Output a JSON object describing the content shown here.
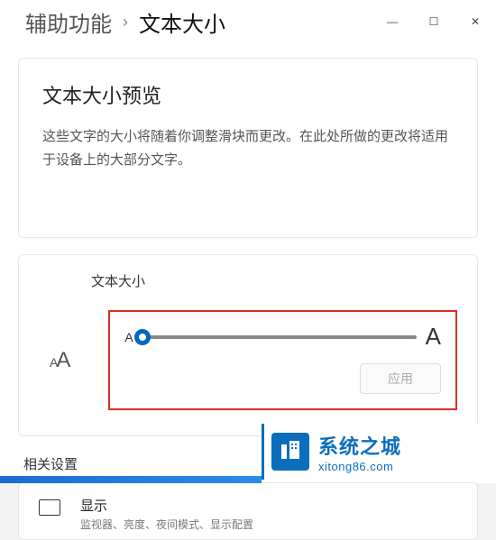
{
  "breadcrumb": {
    "parent": "辅助功能",
    "chevron": "›",
    "current": "文本大小"
  },
  "window_controls": {
    "minimize": "—",
    "maximize": "☐",
    "close": "✕"
  },
  "preview": {
    "title": "文本大小预览",
    "description": "这些文字的大小将随着你调整滑块而更改。在此处所做的更改将适用于设备上的大部分文字。"
  },
  "text_size": {
    "label": "文本大小",
    "icon_small": "A",
    "icon_large": "A",
    "slider_min_label": "A",
    "slider_max_label": "A",
    "apply_label": "应用"
  },
  "related": {
    "title": "相关设置",
    "display": {
      "title": "显示",
      "subtitle": "监视器、亮度、夜间模式、显示配置"
    }
  },
  "watermark": {
    "brand": "系统之城",
    "url": "xitong86.com"
  }
}
